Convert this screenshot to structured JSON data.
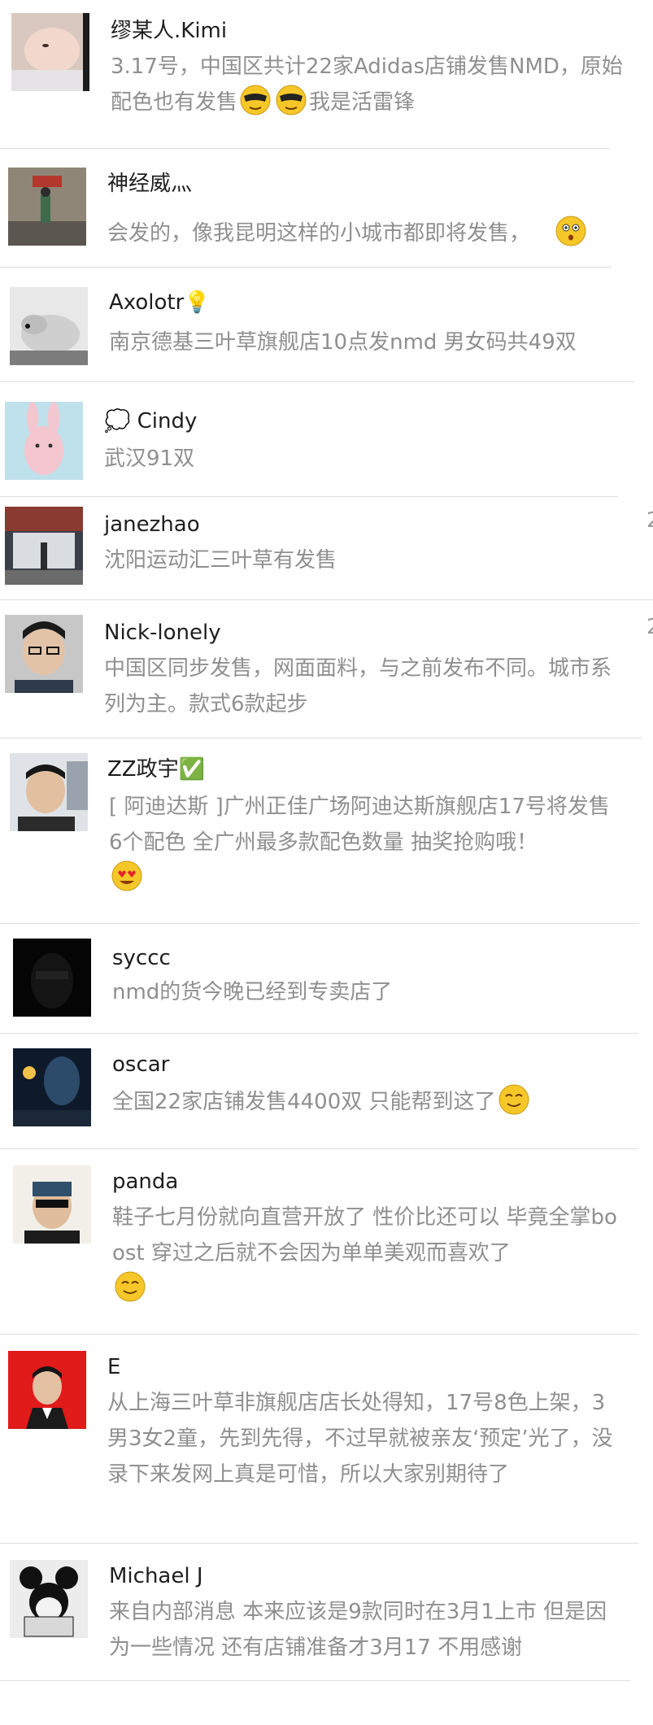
{
  "comments": [
    {
      "name": "缪某人.Kimi",
      "segments": [
        "3.17号，中国区共计22家Adidas店铺发售NMD，原始配色也有发售",
        "我是活雷锋"
      ],
      "emoji": [
        "mask-face-icon",
        "mask-face-icon"
      ]
    },
    {
      "name": "神经威灬",
      "text": "会发的，像我昆明这样的小城市都即将发售，"
    },
    {
      "name": "Axolotr💡",
      "text": "南京德基三叶草旗舰店10点发nmd 男女码共49双"
    },
    {
      "name": "💭 Cindy",
      "text": "武汉91双"
    },
    {
      "name": "janezhao",
      "text": "沈阳运动汇三叶草有发售"
    },
    {
      "name": "Nick-lonely",
      "text": "中国区同步发售，网面面料，与之前发布不同。城市系列为主。款式6款起步"
    },
    {
      "name": "ZZ政宇✅",
      "text": "[ 阿迪达斯 ]广州正佳广场阿迪达斯旗舰店17号将发售6个配色 全广州最多款配色数量 抽奖抢购哦！"
    },
    {
      "name": "syccc",
      "text": "nmd的货今晚已经到专卖店了"
    },
    {
      "name": "oscar",
      "text": "全国22家店铺发售4400双 只能帮到这了"
    },
    {
      "name": "panda",
      "text": "鞋子七月份就向直营开放了 性价比还可以 毕竟全掌boost 穿过之后就不会因为单单美观而喜欢了"
    },
    {
      "name": "E",
      "text": "从上海三叶草非旗舰店店长处得知，17号8色上架，3男3女2童，先到先得，不过早就被亲友‘预定’光了，没录下来发网上真是可惜，所以大家别期待了"
    },
    {
      "name": "Michael J",
      "text": "来自内部消息 本来应该是9款同时在3月1上市 但是因为一些情况 还有店铺准备才3月17 不用感谢"
    }
  ],
  "edge_chars": [
    "2",
    "2"
  ]
}
